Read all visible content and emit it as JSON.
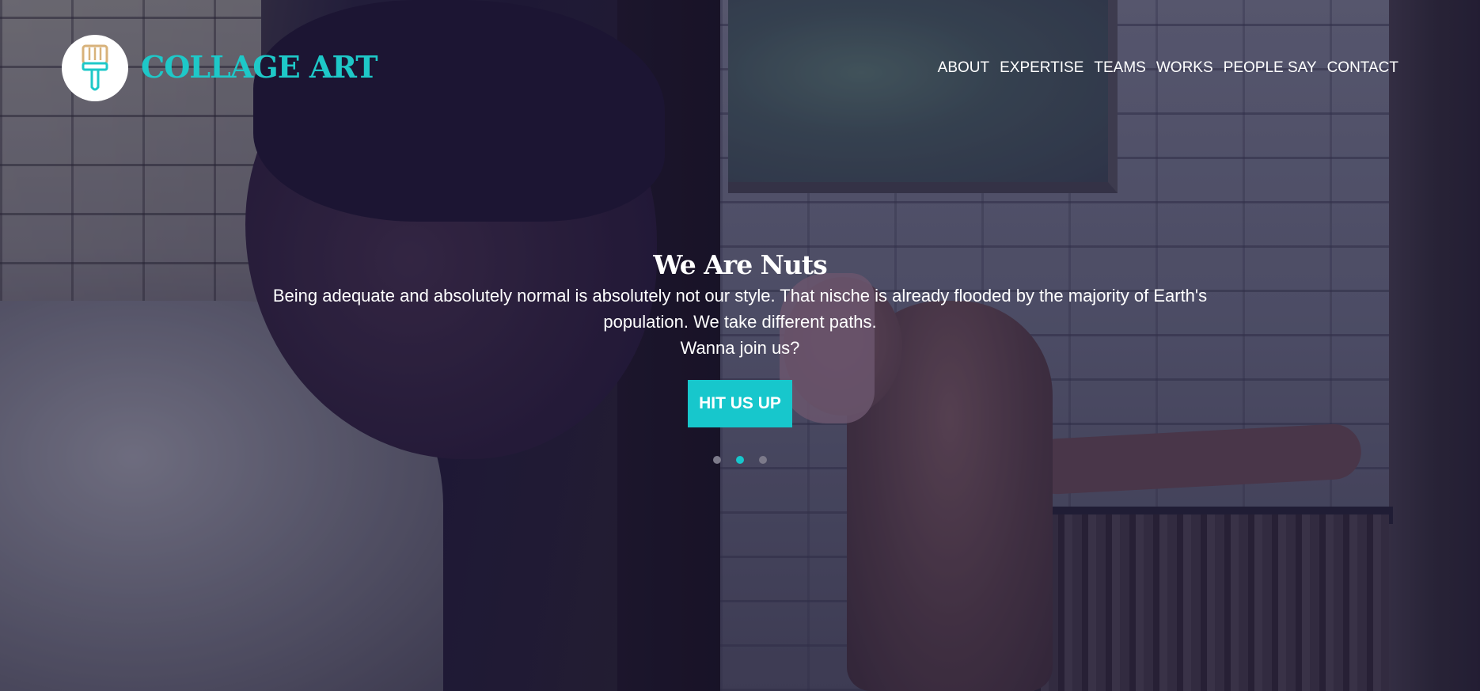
{
  "brand": {
    "name": "COLLAGE ART",
    "logo_icon": "paintbrush-icon",
    "color": "#1ec8c8"
  },
  "nav": {
    "items": [
      {
        "label": "ABOUT"
      },
      {
        "label": "EXPERTISE"
      },
      {
        "label": "TEAMS"
      },
      {
        "label": "WORKS"
      },
      {
        "label": "PEOPLE SAY"
      },
      {
        "label": "CONTACT"
      }
    ]
  },
  "hero": {
    "title": "We Are Nuts",
    "description": "Being adequate and absolutely normal is absolutely not our style. That nische is already flooded by the majority of Earth's population. We take different paths.",
    "question": "Wanna join us?",
    "cta_label": "HIT US UP",
    "cta_color": "#17c7cc",
    "slides": {
      "count": 3,
      "active_index": 1
    }
  }
}
